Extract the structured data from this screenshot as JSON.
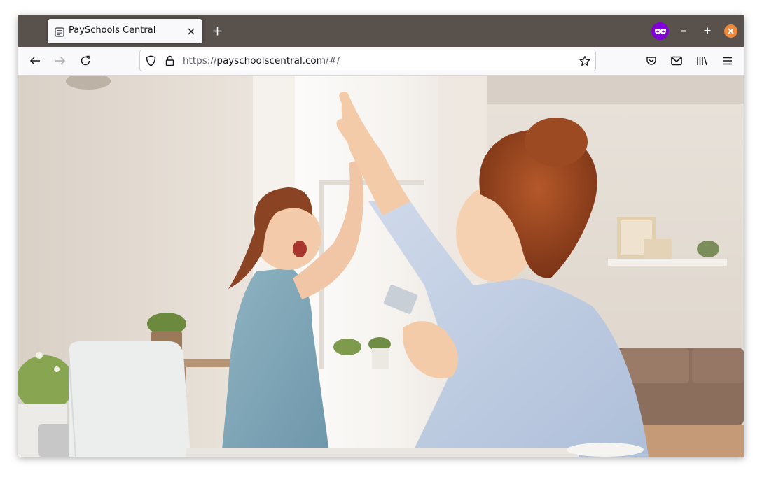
{
  "browser": {
    "tab": {
      "title": "PaySchools Central",
      "favicon": "page-icon"
    },
    "url": {
      "scheme": "https://",
      "host": "payschoolscentral.com",
      "path": "/#/"
    },
    "icons": {
      "back": "arrow-left-icon",
      "forward": "arrow-right-icon",
      "reload": "reload-icon",
      "tracking_protection": "shield-icon",
      "secure": "lock-icon",
      "bookmark": "star-icon",
      "pocket": "pocket-icon",
      "mail": "envelope-icon",
      "library": "library-icon",
      "menu": "hamburger-menu-icon",
      "private_browsing": "private-mask-icon"
    },
    "colors": {
      "titlebar": "#59524c",
      "private": "#8000d7",
      "close": "#f0893a"
    }
  },
  "hero": {
    "image": "hero-photo",
    "alt": "Girl high-fiving her mother who is holding a payment card at a laptop"
  }
}
